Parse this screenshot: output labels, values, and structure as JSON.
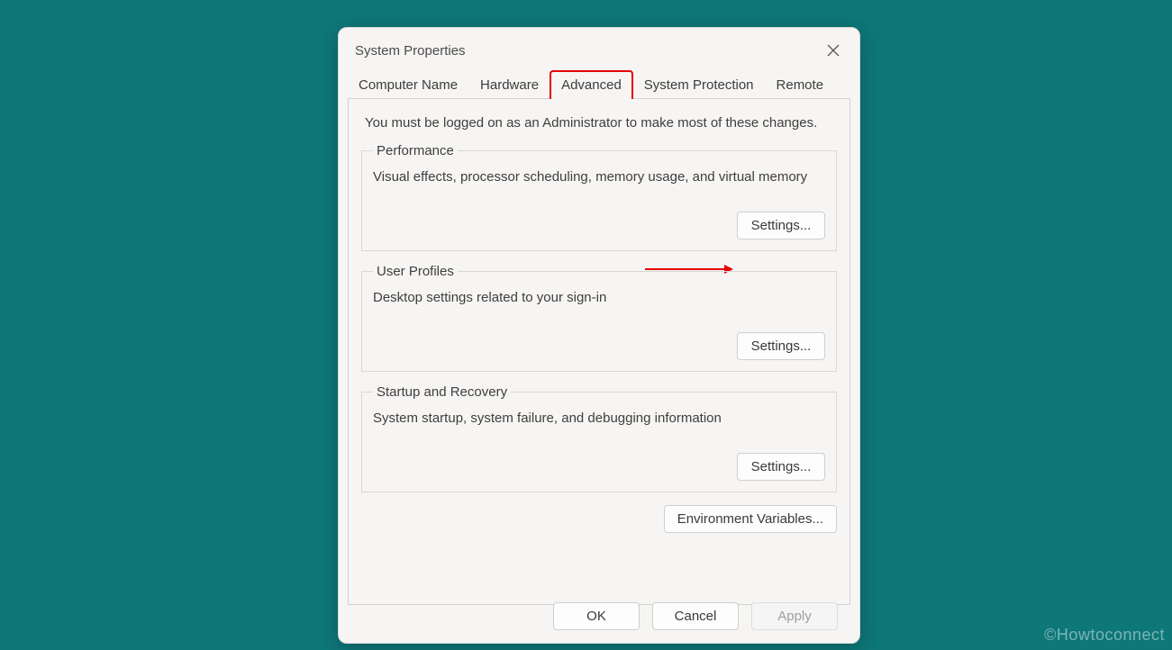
{
  "window": {
    "title": "System Properties"
  },
  "tabs": {
    "computer_name": "Computer Name",
    "hardware": "Hardware",
    "advanced": "Advanced",
    "system_protection": "System Protection",
    "remote": "Remote"
  },
  "admin_note": "You must be logged on as an Administrator to make most of these changes.",
  "groups": {
    "performance": {
      "legend": "Performance",
      "desc": "Visual effects, processor scheduling, memory usage, and virtual memory",
      "button": "Settings..."
    },
    "user_profiles": {
      "legend": "User Profiles",
      "desc": "Desktop settings related to your sign-in",
      "button": "Settings..."
    },
    "startup": {
      "legend": "Startup and Recovery",
      "desc": "System startup, system failure, and debugging information",
      "button": "Settings..."
    }
  },
  "env_button": "Environment Variables...",
  "buttons": {
    "ok": "OK",
    "cancel": "Cancel",
    "apply": "Apply"
  },
  "watermark": "©Howtoconnect"
}
